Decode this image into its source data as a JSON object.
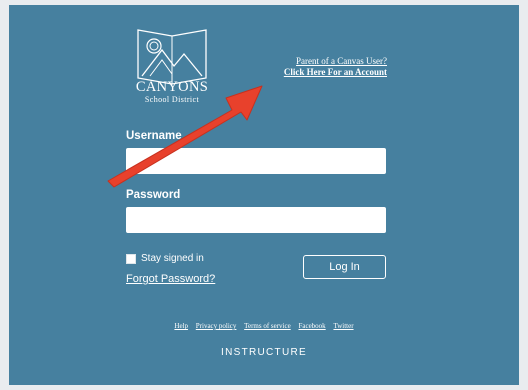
{
  "logo": {
    "name": "CANYONS",
    "subtitle": "School District"
  },
  "parent_link": {
    "line1": "Parent of a Canvas User?",
    "line2": "Click Here For an Account"
  },
  "form": {
    "username_label": "Username",
    "username_value": "",
    "password_label": "Password",
    "password_value": "",
    "stay_signed_in": "Stay signed in",
    "forgot_password": "Forgot Password?",
    "login_button": "Log In"
  },
  "footer": {
    "links": [
      "Help",
      "Privacy policy",
      "Terms of service",
      "Facebook",
      "Twitter"
    ],
    "brand": "INSTRUCTURE"
  },
  "colors": {
    "panel": "#46809f",
    "arrow": "#e8412c",
    "text": "#ffffff"
  }
}
